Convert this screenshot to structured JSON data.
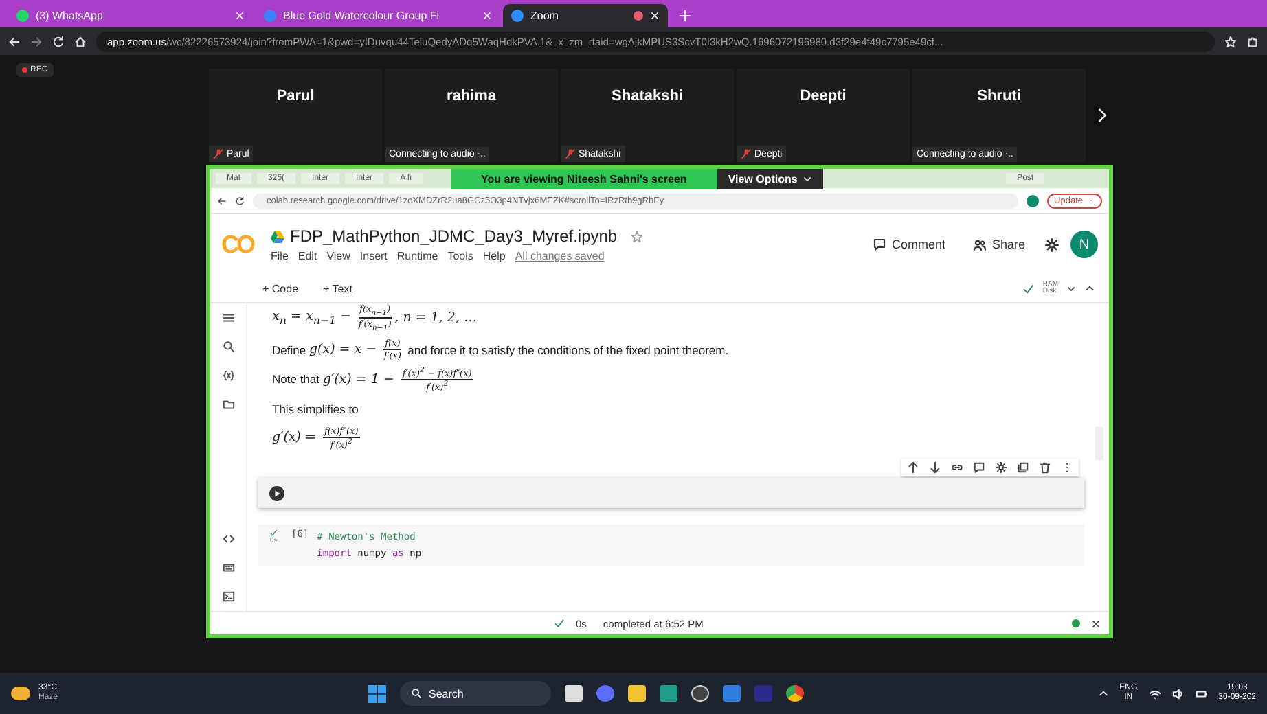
{
  "browser": {
    "tabs": [
      {
        "kind": "whatsapp",
        "label": "(3) WhatsApp",
        "selected": false
      },
      {
        "kind": "site",
        "label": "Blue Gold Watercolour Group Fi",
        "selected": false
      },
      {
        "kind": "zoom",
        "label": "Zoom",
        "selected": true
      }
    ],
    "url_host": "app.zoom.us",
    "url_path": "/wc/82226573924/join?fromPWA=1&pwd=yIDuvqu44TeluQedyADq5WaqHdkPVA.1&_x_zm_rtaid=wgAjkMPUS3ScvT0I3kH2wQ.1696072196980.d3f29e4f49c7795e49cf..."
  },
  "zoom": {
    "recording_badge": "REC",
    "participants": [
      {
        "name": "Parul",
        "label": "Parul",
        "muted": true
      },
      {
        "name": "rahima",
        "label": "Connecting to audio ·..",
        "muted": false
      },
      {
        "name": "Shatakshi",
        "label": "Shatakshi",
        "muted": true
      },
      {
        "name": "Deepti",
        "label": "Deepti",
        "muted": true
      },
      {
        "name": "Shruti",
        "label": "Connecting to audio ·..",
        "muted": false
      }
    ],
    "banner": "You are viewing  Niteesh Sahni's screen",
    "view_options": "View Options"
  },
  "shared_screen": {
    "tabs": [
      "Mat",
      "325(",
      "Inter",
      "Inter",
      "A fr",
      "Post"
    ],
    "url": "colab.research.google.com/drive/1zoXMDZrR2ua8GCz5O3p4NTvjx6MEZK#scrollTo=IRzRtb9gRhEy",
    "update": "Update",
    "notebook": {
      "logo": "CO",
      "title": "FDP_MathPython_JDMC_Day3_Myref.ipynb",
      "menus": [
        "File",
        "Edit",
        "View",
        "Insert",
        "Runtime",
        "Tools",
        "Help"
      ],
      "saved": "All changes saved",
      "comment": "Comment",
      "share": "Share",
      "avatar": "N",
      "add_code": "+ Code",
      "add_text": "+ Text",
      "ram": "RAM",
      "disk": "Disk",
      "lines": [
        {
          "parts": [
            {
              "kind": "math",
              "s": "x$_{n}$ = x$_{n−1}$ − "
            },
            {
              "kind": "frac",
              "num": "f(x$_{n−1}$)",
              "den": "f′(x$_{n−1}$)"
            },
            {
              "kind": "math",
              "s": ", n = 1, 2, …"
            }
          ]
        },
        {
          "parts": [
            {
              "kind": "text",
              "s": "Define "
            },
            {
              "kind": "math",
              "s": "g(x) = x − "
            },
            {
              "kind": "frac",
              "num": "f(x)",
              "den": "f′(x)"
            },
            {
              "kind": "text",
              "s": " and force it to satisfy the conditions of the fixed point theorem."
            }
          ]
        },
        {
          "parts": [
            {
              "kind": "text",
              "s": "Note that "
            },
            {
              "kind": "math",
              "s": "g′(x) = 1 − "
            },
            {
              "kind": "frac",
              "num": "f′(x)$^{2}$ − f(x)f″(x)",
              "den": "f′(x)$^{2}$"
            }
          ]
        },
        {
          "parts": [
            {
              "kind": "text",
              "s": "This simplifies to"
            }
          ]
        },
        {
          "parts": [
            {
              "kind": "math",
              "s": "g′(x) = "
            },
            {
              "kind": "frac",
              "num": "f(x)f″(x)",
              "den": "f′(x)$^{2}$"
            }
          ]
        }
      ],
      "code_cell": {
        "count": "[6]",
        "time": "0s",
        "lines": [
          [
            {
              "kind": "comment",
              "s": "# Newton's Method"
            }
          ],
          [
            {
              "kind": "keyword",
              "s": "import"
            },
            {
              "kind": "plain",
              "s": " numpy "
            },
            {
              "kind": "keyword",
              "s": "as"
            },
            {
              "kind": "plain",
              "s": " np"
            }
          ]
        ]
      },
      "status_time": "0s",
      "status": "completed at 6:52 PM"
    }
  },
  "taskbar": {
    "temperature": "33°C",
    "weather": "Haze",
    "search": "Search",
    "language": "ENG",
    "region": "IN",
    "time": "19:03",
    "date": "30-09-202"
  }
}
